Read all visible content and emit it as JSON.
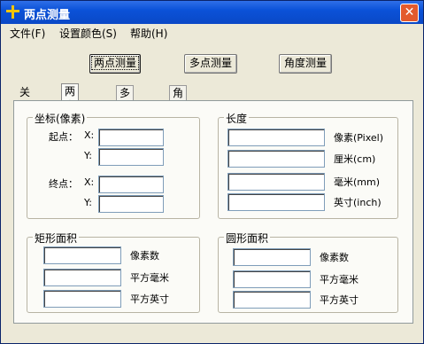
{
  "window": {
    "title": "两点测量",
    "close_icon": "close-icon"
  },
  "menu": [
    "文件(F)",
    "设置颜色(S)",
    "帮助(H)"
  ],
  "mode_buttons": [
    "两点测量",
    "多点测量",
    "角度测量"
  ],
  "tabs": [
    "关于",
    "两点测量",
    "多点测量",
    "角度测量"
  ],
  "coord": {
    "title": "坐标(像素)",
    "start_label": "起点：",
    "end_label": "终点：",
    "x_label": "X:",
    "y_label": "Y:"
  },
  "length": {
    "title": "长度",
    "units": [
      "像素(Pixel)",
      "厘米(cm)",
      "毫米(mm)",
      "英寸(inch)"
    ]
  },
  "rect_area": {
    "title": "矩形面积",
    "units": [
      "像素数",
      "平方毫米",
      "平方英寸"
    ]
  },
  "circle_area": {
    "title": "圆形面积",
    "units": [
      "像素数",
      "平方毫米",
      "平方英寸"
    ]
  }
}
